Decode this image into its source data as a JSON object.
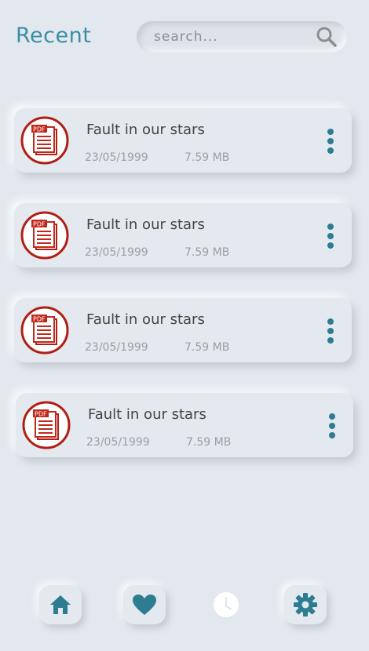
{
  "header": {
    "title": "Recent"
  },
  "search": {
    "placeholder": "search..."
  },
  "files": [
    {
      "name": "Fault in our stars",
      "date": "23/05/1999",
      "size": "7.59 MB",
      "type": "PDF"
    },
    {
      "name": "Fault in our stars",
      "date": "23/05/1999",
      "size": "7.59 MB",
      "type": "PDF"
    },
    {
      "name": "Fault in our stars",
      "date": "23/05/1999",
      "size": "7.59 MB",
      "type": "PDF"
    },
    {
      "name": "Fault in our stars",
      "date": "23/05/1999",
      "size": "7.59 MB",
      "type": "PDF"
    }
  ],
  "bottom_nav": [
    {
      "icon": "home-icon"
    },
    {
      "icon": "heart-icon"
    },
    {
      "icon": "clock-icon"
    },
    {
      "icon": "gear-icon"
    }
  ],
  "colors": {
    "accent": "#2d7c92",
    "title": "#3b8ea6",
    "background": "#e2e8ee",
    "pdf_red": "#c0281c"
  }
}
